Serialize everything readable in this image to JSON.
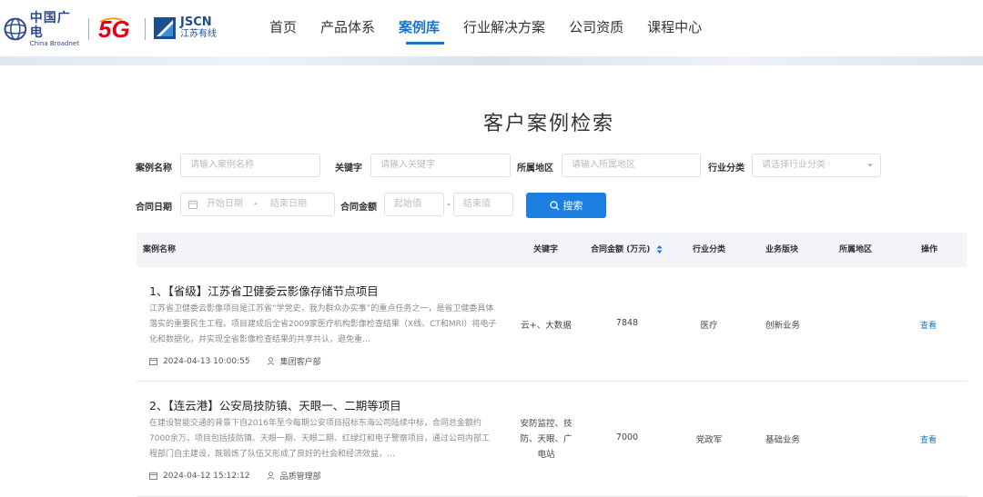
{
  "header": {
    "logo_cbn_cn": "中国广电",
    "logo_cbn_en": "China Broadnet",
    "logo_5g": "5G",
    "logo_jscn_en": "JSCN",
    "logo_jscn_cn": "江苏有线",
    "nav": [
      "首页",
      "产品体系",
      "案例库",
      "行业解决方案",
      "公司资质",
      "课程中心"
    ],
    "active_nav": "案例库"
  },
  "page_title": "客户案例检索",
  "filters": {
    "case_name_label": "案例名称",
    "case_name_placeholder": "请输入案例名称",
    "keyword_label": "关键字",
    "keyword_placeholder": "请输入关键字",
    "region_label": "所属地区",
    "region_placeholder": "请输入所属地区",
    "industry_label": "行业分类",
    "industry_placeholder": "请选择行业分类",
    "contract_date_label": "合同日期",
    "start_date_placeholder": "开始日期",
    "date_separator": "-",
    "end_date_placeholder": "结束日期",
    "contract_amount_label": "合同金额",
    "min_placeholder": "起始值",
    "amount_separator": "-",
    "max_placeholder": "结束值",
    "search_button": "搜索"
  },
  "table": {
    "headers": {
      "name": "案例名称",
      "keyword": "关键字",
      "amount": "合同金额 (万元)",
      "industry": "行业分类",
      "business": "业务版块",
      "region": "所属地区",
      "action": "操作"
    },
    "rows": [
      {
        "title": "1、【省级】江苏省卫健委云影像存储节点项目",
        "desc": "江苏省卫健委云影像项目是江苏省“学党史，我为群众办实事”的重点任务之一，是省卫健委具体落实的重要民生工程。项目建成后全省2009家医疗机构影像检查结果（X线、CT和MRI）将电子化和数据化，并实现全省影像检查结果的共享共认，避免重…",
        "date": "2024-04-13 10:00:55",
        "dept": "集团客户部",
        "keyword": "云+、大数据",
        "amount": "7848",
        "industry": "医疗",
        "business": "创新业务",
        "region": "",
        "action": "查看"
      },
      {
        "title": "2、【连云港】公安局技防镇、天眼一、二期等项目",
        "desc": "在建设智能交通的背景下自2016年至今每期公安项目招标东海公司陆续中标，合同总金额约7000余万。项目包括技防镇、天眼一期、天眼二期、红绿灯和电子警察项目，通过公司内部工程部门自主建设，既锻炼了队伍又形成了良好的社会和经济效益，…",
        "date": "2024-04-12 15:12:12",
        "dept": "品质管理部",
        "keyword": "安防监控、技防、天眼、广电站",
        "amount": "7000",
        "industry": "党政军",
        "business": "基础业务",
        "region": "",
        "action": "查看"
      }
    ]
  },
  "colors": {
    "accent": "#1a73c8",
    "button": "#1a7fe0",
    "brand_red": "#e60012",
    "brand_blue": "#1d4e92"
  }
}
